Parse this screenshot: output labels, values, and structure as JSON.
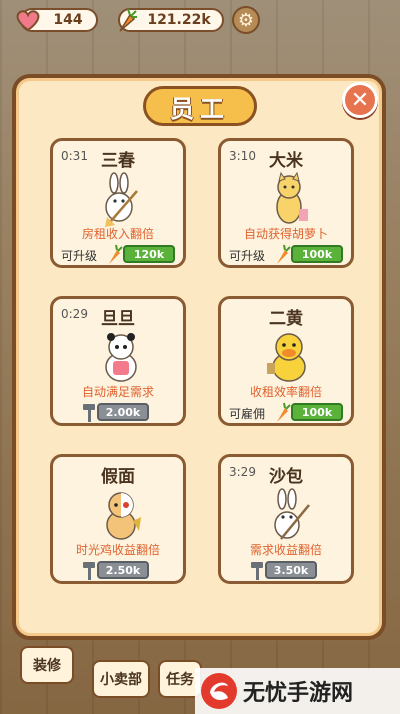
{
  "topbar": {
    "hearts": "144",
    "carrots": "121.22k",
    "heart_icon": "heart-icon",
    "carrot_icon": "carrot-icon",
    "settings_icon": "gear-icon"
  },
  "dialog": {
    "title": "员工",
    "close_icon": "close-icon"
  },
  "cards": [
    {
      "timer": "0:31",
      "name": "三春",
      "desc": "房租收入翻倍",
      "status": "可升级",
      "cost": "120k",
      "cost_style": "green",
      "cost_icon": "carrot-icon"
    },
    {
      "timer": "3:10",
      "name": "大米",
      "desc": "自动获得胡萝卜",
      "status": "可升级",
      "cost": "100k",
      "cost_style": "green",
      "cost_icon": "carrot-icon"
    },
    {
      "timer": "0:29",
      "name": "旦旦",
      "desc": "自动满足需求",
      "status": "",
      "cost": "2.00k",
      "cost_style": "grey",
      "cost_icon": "hammer-icon"
    },
    {
      "timer": "",
      "name": "二黄",
      "desc": "收租效率翻倍",
      "status": "可雇佣",
      "cost": "100k",
      "cost_style": "green",
      "cost_icon": "carrot-icon"
    },
    {
      "timer": "",
      "name": "假面",
      "desc": "时光鸡收益翻倍",
      "status": "",
      "cost": "2.50k",
      "cost_style": "grey",
      "cost_icon": "hammer-icon"
    },
    {
      "timer": "3:29",
      "name": "沙包",
      "desc": "需求收益翻倍",
      "status": "",
      "cost": "3.50k",
      "cost_style": "grey",
      "cost_icon": "hammer-icon"
    }
  ],
  "bottom": {
    "decorate": "装修",
    "shop": "小卖部",
    "tasks": "任务"
  },
  "watermark": {
    "text": "无忧手游网"
  },
  "colors": {
    "panel_bg": "#fce9c3",
    "panel_border": "#7b4d27",
    "accent_orange": "#e0622f",
    "cost_green": "#5ab23b",
    "cost_grey": "#8a8f96"
  }
}
